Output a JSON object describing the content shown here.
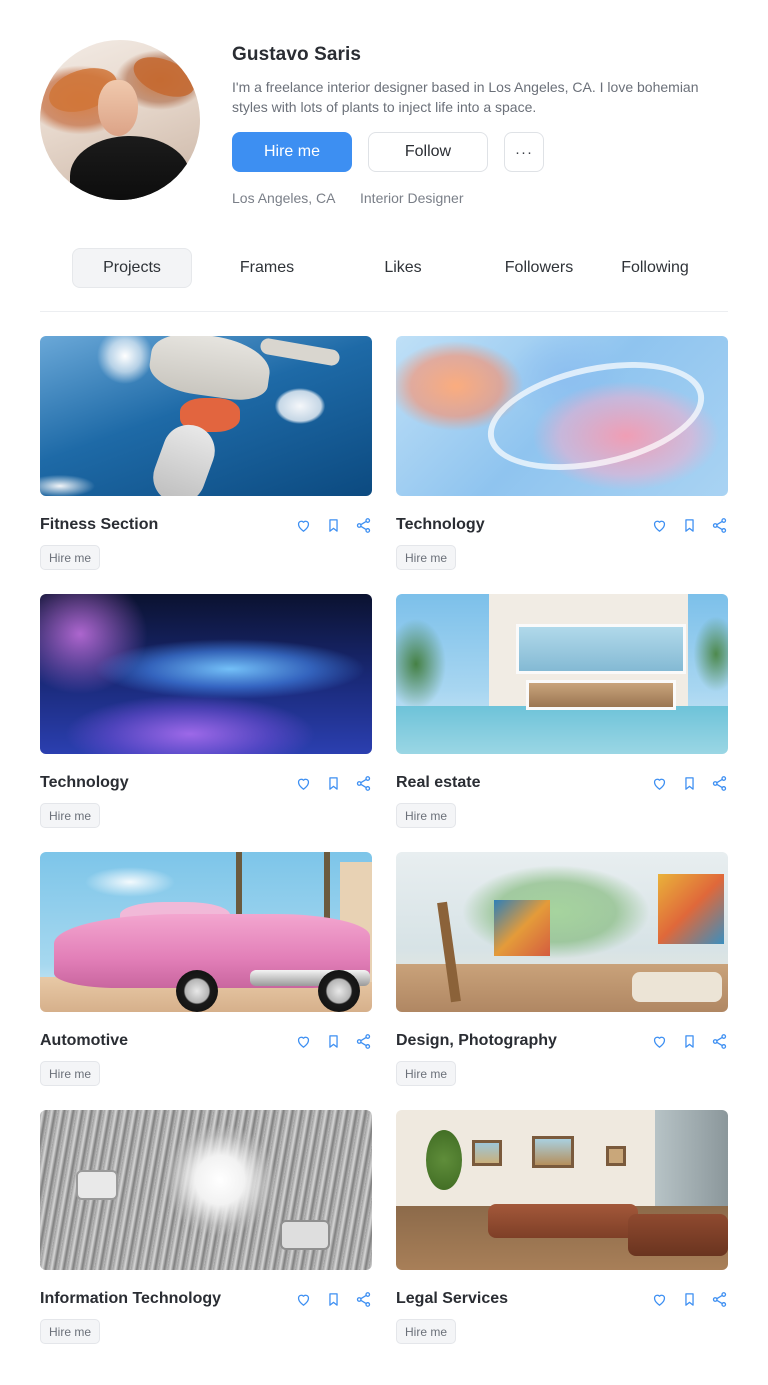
{
  "profile": {
    "name": "Gustavo Saris",
    "bio": "I'm a freelance interior designer based in Los Angeles, CA. I love bohemian styles with lots of plants to inject life into a space.",
    "hire_label": "Hire me",
    "follow_label": "Follow",
    "more_label": "···",
    "location": "Los Angeles, CA",
    "role": "Interior Designer"
  },
  "tabs": [
    {
      "label": "Projects",
      "active": true
    },
    {
      "label": "Frames",
      "active": false
    },
    {
      "label": "Likes",
      "active": false
    },
    {
      "label": "Followers",
      "active": false
    },
    {
      "label": "Following",
      "active": false
    }
  ],
  "projects": [
    {
      "title": "Fitness Section",
      "tag": "Hire me"
    },
    {
      "title": "Technology",
      "tag": "Hire me"
    },
    {
      "title": "Technology",
      "tag": "Hire me"
    },
    {
      "title": "Real estate",
      "tag": "Hire me"
    },
    {
      "title": "Automotive",
      "tag": "Hire me"
    },
    {
      "title": "Design, Photography",
      "tag": "Hire me"
    },
    {
      "title": "Information Technology",
      "tag": "Hire me"
    },
    {
      "title": "Legal Services",
      "tag": "Hire me"
    }
  ],
  "icons": {
    "like": "heart-icon",
    "save": "bookmark-icon",
    "share": "share-icon",
    "more": "ellipsis-icon"
  },
  "colors": {
    "accent": "#3d8ff2",
    "text": "#2a2d33",
    "muted": "#6b7079"
  }
}
